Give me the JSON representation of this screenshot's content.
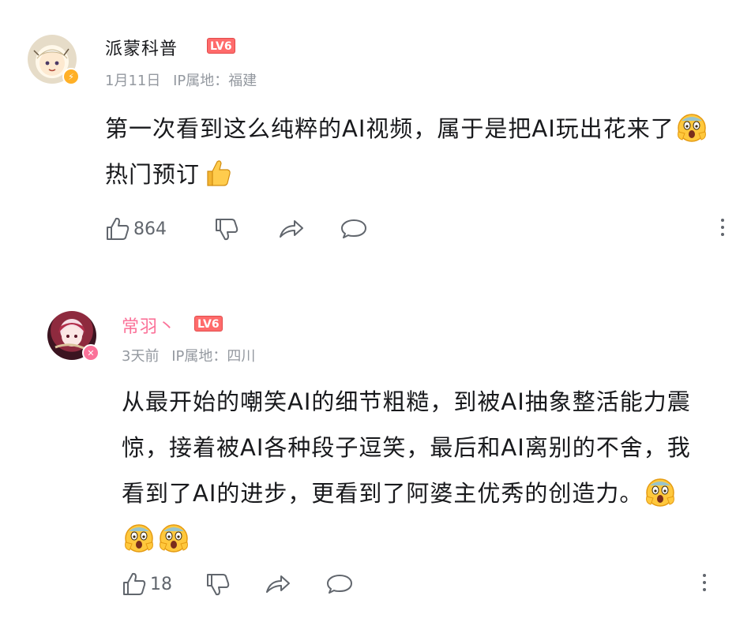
{
  "comments": [
    {
      "username": "派蒙科普",
      "level": "LV6",
      "date": "1月11日",
      "ip_location": "IP属地：福建",
      "text_part1": "第一次看到这么纯粹的AI视频，属于是把AI玩出花来了",
      "text_part2": "热门预订",
      "emojis": [
        "scream-face-emoji",
        "thumbs-up-emoji"
      ],
      "likes": "864",
      "username_color": "#18191c",
      "badge_color": "#ffb027"
    },
    {
      "username": "常羽丶",
      "level": "LV6",
      "date": "3天前",
      "ip_location": "IP属地：四川",
      "text": "从最开始的嘲笑AI的细节粗糙，到被AI抽象整活能力震惊，接着被AI各种段子逗笑，最后和AI离别的不舍，我看到了AI的进步，更看到了阿婆主优秀的创造力。",
      "emojis": [
        "scream-face-emoji",
        "scream-face-emoji",
        "scream-face-emoji"
      ],
      "likes": "18",
      "username_color": "#fb7299",
      "badge_color": "#fb7299"
    }
  ],
  "colors": {
    "level_badge": "#ff6b6b",
    "icon_gray": "#61666d",
    "meta_gray": "#9499a0"
  },
  "icons": {
    "like": "thumbs-up-outline-icon",
    "dislike": "thumbs-down-outline-icon",
    "share": "share-arrow-icon",
    "reply": "speech-bubble-icon",
    "more": "vertical-dots-icon"
  }
}
